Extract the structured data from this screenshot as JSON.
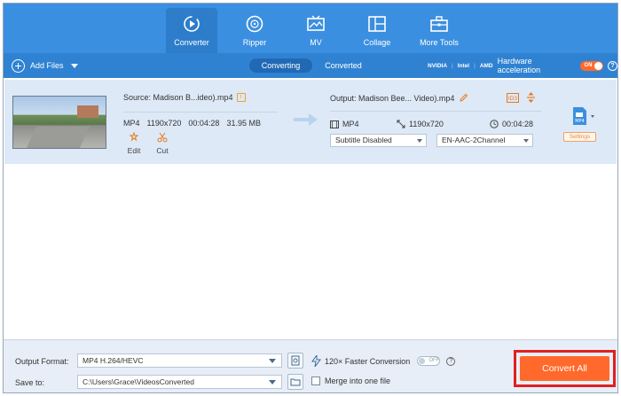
{
  "nav": {
    "items": [
      {
        "label": "Converter",
        "icon": "converter-icon",
        "active": true
      },
      {
        "label": "Ripper",
        "icon": "disc-icon",
        "active": false
      },
      {
        "label": "MV",
        "icon": "mv-icon",
        "active": false
      },
      {
        "label": "Collage",
        "icon": "collage-icon",
        "active": false
      },
      {
        "label": "More Tools",
        "icon": "toolbox-icon",
        "active": false
      }
    ]
  },
  "toolbar": {
    "add_files": "Add Files",
    "tabs": {
      "converting": "Converting",
      "converted": "Converted"
    },
    "hw_brands": {
      "nvidia": "NVIDIA",
      "intel": "Intel",
      "amd": "AMD"
    },
    "hw_label": "Hardware acceleration",
    "hw_toggle": "ON"
  },
  "file": {
    "source_name": "Source: Madison B...ideo).mp4",
    "source_format": "MP4",
    "source_resolution": "1190x720",
    "source_duration": "00:04:28",
    "source_size": "31.95 MB",
    "edit_label": "Edit",
    "cut_label": "Cut",
    "output_name": "Output: Madison Bee... Video).mp4",
    "output_format": "MP4",
    "output_resolution": "1190x720",
    "output_duration": "00:04:28",
    "subtitle": "Subtitle Disabled",
    "audio": "EN-AAC-2Channel",
    "settings_label": "Settings",
    "format_badge": "MP4"
  },
  "bottom": {
    "output_format_label": "Output Format:",
    "output_format_value": "MP4 H.264/HEVC",
    "save_to_label": "Save to:",
    "save_to_value": "C:\\Users\\Grace\\VideosConverted",
    "fast_conversion": "120× Faster Conversion",
    "fast_toggle": "OFF",
    "merge_label": "Merge into one file",
    "convert_all": "Convert All"
  },
  "colors": {
    "nav_bg": "#3b8fe0",
    "toolbar_bg": "#2f82d2",
    "accent_orange": "#ff6a2c",
    "highlight_red": "#e02020"
  }
}
